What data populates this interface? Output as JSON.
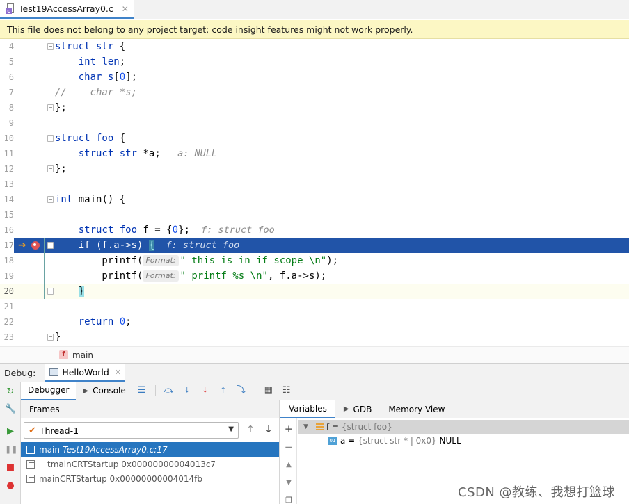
{
  "editor_tab": {
    "filename": "Test19AccessArray0.c",
    "close": "✕"
  },
  "banner": {
    "text": "This file does not belong to any project target; code insight features might not work properly."
  },
  "code_lines": [
    {
      "num": "4",
      "segs": [
        [
          "kw",
          "struct"
        ],
        [
          "",
          ""
        ],
        [
          "ty",
          " str"
        ],
        [
          "",
          " {"
        ]
      ]
    },
    {
      "num": "5",
      "segs": [
        [
          "",
          "    "
        ],
        [
          "kw",
          "int"
        ],
        [
          "",
          " "
        ],
        [
          "ty",
          "len"
        ],
        [
          "",
          ";"
        ]
      ]
    },
    {
      "num": "6",
      "segs": [
        [
          "",
          "    "
        ],
        [
          "kw",
          "char"
        ],
        [
          "",
          " "
        ],
        [
          "ty",
          "s"
        ],
        [
          "",
          "["
        ],
        [
          "num",
          "0"
        ],
        [
          "",
          "];"
        ]
      ]
    },
    {
      "num": "7",
      "segs": [
        [
          "cmt",
          "//    char *s;"
        ]
      ]
    },
    {
      "num": "8",
      "segs": [
        [
          "",
          "};"
        ]
      ]
    },
    {
      "num": "9",
      "segs": []
    },
    {
      "num": "10",
      "segs": [
        [
          "kw",
          "struct"
        ],
        [
          "ty",
          " foo"
        ],
        [
          "",
          " {"
        ]
      ]
    },
    {
      "num": "11",
      "segs": [
        [
          "",
          "    "
        ],
        [
          "kw",
          "struct"
        ],
        [
          "ty",
          " str"
        ],
        [
          "",
          " *"
        ],
        [
          "",
          "a"
        ],
        [
          "",
          ";"
        ],
        [
          "hint",
          "   a: NULL"
        ]
      ]
    },
    {
      "num": "12",
      "segs": [
        [
          "",
          "};"
        ]
      ]
    },
    {
      "num": "13",
      "segs": []
    },
    {
      "num": "14",
      "segs": [
        [
          "kw",
          "int"
        ],
        [
          "",
          " "
        ],
        [
          "",
          "main"
        ],
        [
          "",
          "() {"
        ]
      ]
    },
    {
      "num": "15",
      "segs": []
    },
    {
      "num": "16",
      "segs": [
        [
          "",
          "    "
        ],
        [
          "kw",
          "struct"
        ],
        [
          "ty",
          " foo"
        ],
        [
          "",
          " f = {"
        ],
        [
          "num",
          "0"
        ],
        [
          "",
          "};"
        ],
        [
          "hint",
          "  f: struct foo"
        ]
      ]
    },
    {
      "num": "17",
      "segs": [
        [
          "",
          "    if (f.a->s) "
        ],
        [
          "brace",
          "{"
        ],
        [
          "hint",
          "  f: struct foo"
        ]
      ]
    },
    {
      "num": "18",
      "segs": [
        [
          "",
          "        printf("
        ],
        [
          "param",
          "Format:"
        ],
        [
          "str",
          "\" this is in if scope \\n\""
        ],
        [
          "",
          ");"
        ]
      ]
    },
    {
      "num": "19",
      "segs": [
        [
          "",
          "        printf("
        ],
        [
          "param",
          "Format:"
        ],
        [
          "str",
          "\" printf %s \\n\""
        ],
        [
          "",
          ", f.a->s);"
        ]
      ]
    },
    {
      "num": "20",
      "segs": [
        [
          "",
          "    "
        ],
        [
          "bracehl",
          "}"
        ]
      ]
    },
    {
      "num": "21",
      "segs": []
    },
    {
      "num": "22",
      "segs": [
        [
          "",
          "    "
        ],
        [
          "kw",
          "return"
        ],
        [
          "",
          " "
        ],
        [
          "num",
          "0"
        ],
        [
          "",
          ";"
        ]
      ]
    },
    {
      "num": "23",
      "segs": [
        [
          "",
          "}"
        ]
      ]
    }
  ],
  "breadcrumb": {
    "badge": "f",
    "label": "main"
  },
  "debug": {
    "label": "Debug:",
    "session": "HelloWorld",
    "session_close": "✕",
    "tabs": {
      "debugger": "Debugger",
      "console": "Console"
    },
    "frames_title": "Frames",
    "thread": "Thread-1",
    "frames": [
      {
        "name": "main",
        "loc": "Test19AccessArray0.c:17"
      },
      {
        "name": "__tmainCRTStartup 0x00000000004013c7",
        "loc": ""
      },
      {
        "name": "mainCRTStartup 0x00000000004014fb",
        "loc": ""
      }
    ],
    "var_tabs": {
      "variables": "Variables",
      "gdb": "GDB",
      "memory": "Memory View"
    },
    "variables": [
      {
        "name": "f",
        "eq": " = ",
        "value": "{struct foo}",
        "extra": ""
      },
      {
        "name": "a",
        "eq": " = ",
        "value": "{struct str * | 0x0}",
        "extra": " NULL"
      }
    ]
  },
  "watermark": "CSDN @教练、我想打篮球",
  "colors": {
    "exec_line": "#2154a8",
    "selection": "#2675bf",
    "banner": "#fcf7c4",
    "accent": "#4083c9"
  },
  "icons": [
    "file-c-icon",
    "fold-icon",
    "exec-arrow-icon",
    "breakpoint-icon",
    "rerun-icon",
    "resume-icon",
    "pause-icon",
    "stop-icon",
    "step-over-icon",
    "step-into-icon",
    "step-out-icon",
    "frame-icon",
    "struct-icon",
    "field-icon"
  ]
}
